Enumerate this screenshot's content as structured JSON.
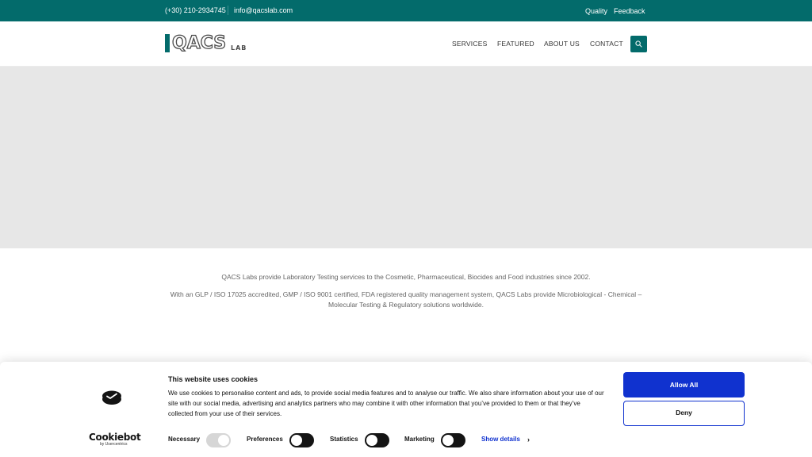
{
  "topbar": {
    "phone": "(+30) 210-2934745",
    "email": "info@qacslab.com",
    "links": [
      "Quality",
      "Feedback"
    ]
  },
  "header": {
    "logo_text": "QACS",
    "logo_sub": "LAB",
    "nav": [
      "SERVICES",
      "FEATURED",
      "ABOUT US",
      "CONTACT"
    ],
    "search_icon": "search-icon"
  },
  "intro": {
    "line1": "QACS Labs provide Laboratory Testing services to the Cosmetic, Pharmaceutical, Biocides and Food industries since 2002.",
    "line2": "With an GLP / ISO 17025 accredited, GMP / ISO 9001 certified, FDA registered quality management system, QACS Labs provide Microbiological - Chemical – Molecular Testing & Regulatory solutions worldwide."
  },
  "cookie": {
    "brand": "Cookiebot",
    "brand_by": "by Usercentrics",
    "title": "This website uses cookies",
    "text": "We use cookies to personalise content and ads, to provide social media features and to analyse our traffic. We also share information about your use of our site with our social media, advertising and analytics partners who may combine it with other information that you’ve provided to them or that they’ve collected from your use of their services.",
    "toggles": [
      {
        "label": "Necessary",
        "state": "on-disabled"
      },
      {
        "label": "Preferences",
        "state": "off"
      },
      {
        "label": "Statistics",
        "state": "off"
      },
      {
        "label": "Marketing",
        "state": "off"
      }
    ],
    "show_details": "Show details",
    "allow_all": "Allow All",
    "deny": "Deny"
  },
  "colors": {
    "brand_teal": "#036b6b",
    "cookie_blue": "#1032cf"
  }
}
